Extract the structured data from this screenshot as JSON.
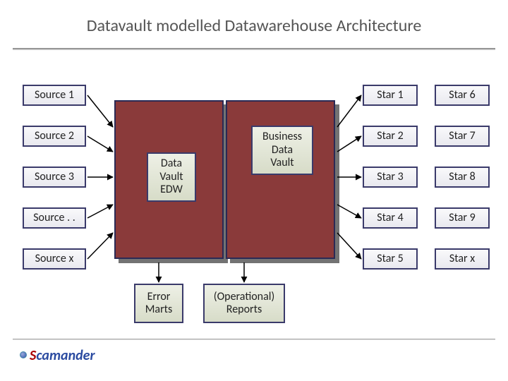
{
  "title": "Datavault modelled Datawarehouse Architecture",
  "sources": [
    "Source 1",
    "Source 2",
    "Source 3",
    "Source . .",
    "Source x"
  ],
  "stars_col1": [
    "Star 1",
    "Star 2",
    "Star 3",
    "Star 4",
    "Star 5"
  ],
  "stars_col2": [
    "Star 6",
    "Star 7",
    "Star 8",
    "Star 9",
    "Star x"
  ],
  "center": {
    "dv": "Data\nVault\nEDW",
    "bdv": "Business\nData\nVault",
    "error_marts": "Error\nMarts",
    "op_reports": "(Operational)\nReports"
  },
  "logo": {
    "brand_prefix": "S",
    "brand_rest": "camander"
  }
}
